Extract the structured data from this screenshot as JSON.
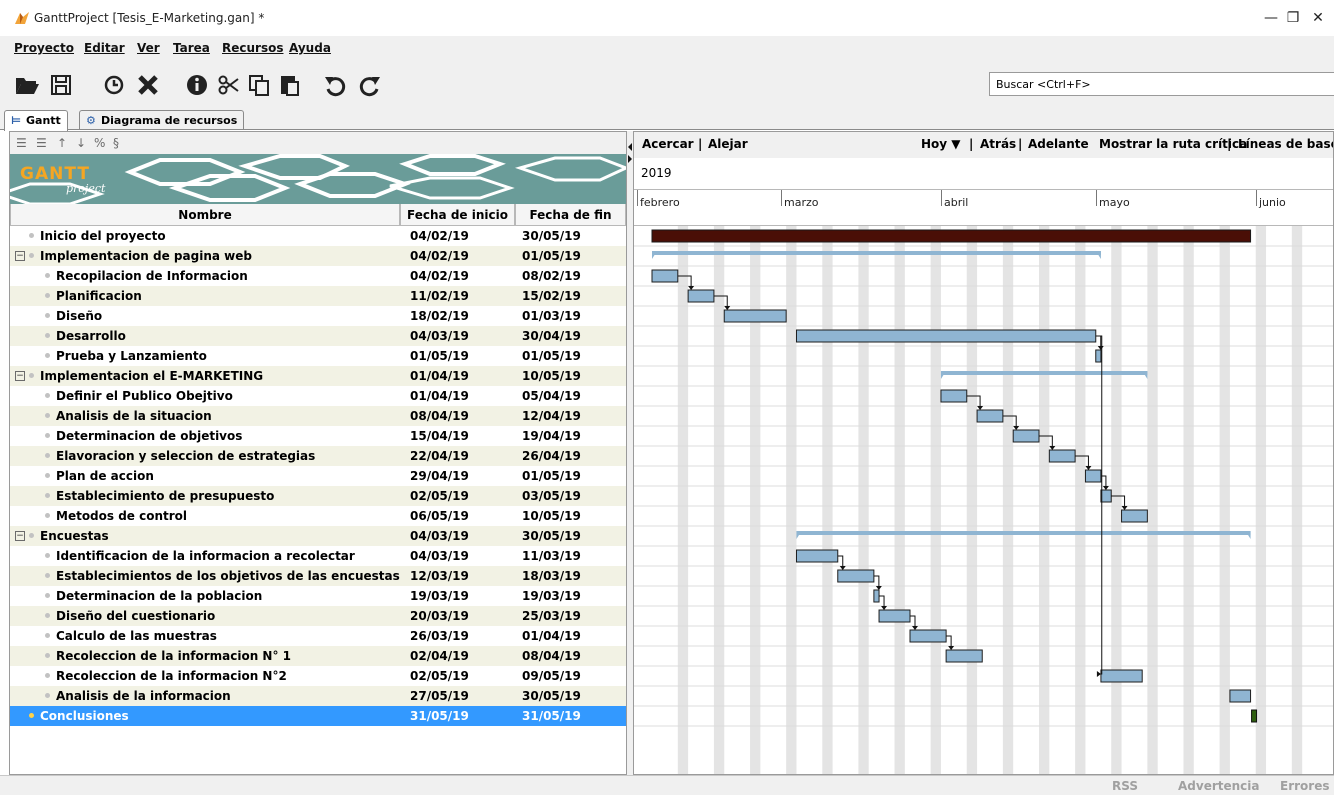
{
  "window": {
    "title": "GanttProject [Tesis_E-Marketing.gan] *",
    "minimize": "—",
    "restore": "❐",
    "close": "✕"
  },
  "menu": [
    "Proyecto",
    "Editar",
    "Ver",
    "Tarea",
    "Recursos",
    "Ayuda"
  ],
  "toolbar": {
    "icons": [
      "folder-open-icon",
      "save-icon",
      "clock-icon",
      "delete-icon",
      "info-icon",
      "cut-icon",
      "copy-icon",
      "paste-icon",
      "undo-icon",
      "redo-icon"
    ],
    "search_value": "Buscar <Ctrl+F>"
  },
  "tabs": [
    {
      "label": "Gantt",
      "icon": "gantt-icon",
      "active": true
    },
    {
      "label": "Diagrama de recursos",
      "icon": "resources-icon",
      "active": false
    }
  ],
  "tree_toolbar": [
    "indent-icon",
    "outdent-icon",
    "move-up-icon",
    "move-down-icon",
    "link-icon",
    "unlink-icon"
  ],
  "banner": {
    "logo_main": "GANTT",
    "logo_sub": "project"
  },
  "columns": {
    "name": "Nombre",
    "start": "Fecha de inicio",
    "end": "Fecha de fin"
  },
  "tasks": [
    {
      "name": "Inicio del proyecto",
      "start": "04/02/19",
      "end": "30/05/19",
      "level": 1,
      "group": false
    },
    {
      "name": "Implementacion de pagina web",
      "start": "04/02/19",
      "end": "01/05/19",
      "level": 1,
      "group": true
    },
    {
      "name": "Recopilacion de Informacion",
      "start": "04/02/19",
      "end": "08/02/19",
      "level": 2,
      "group": false
    },
    {
      "name": "Planificacion",
      "start": "11/02/19",
      "end": "15/02/19",
      "level": 2,
      "group": false
    },
    {
      "name": "Diseño",
      "start": "18/02/19",
      "end": "01/03/19",
      "level": 2,
      "group": false
    },
    {
      "name": "Desarrollo",
      "start": "04/03/19",
      "end": "30/04/19",
      "level": 2,
      "group": false
    },
    {
      "name": "Prueba y Lanzamiento",
      "start": "01/05/19",
      "end": "01/05/19",
      "level": 2,
      "group": false
    },
    {
      "name": "Implementacion el E-MARKETING",
      "start": "01/04/19",
      "end": "10/05/19",
      "level": 1,
      "group": true
    },
    {
      "name": "Definir el Publico Obejtivo",
      "start": "01/04/19",
      "end": "05/04/19",
      "level": 2,
      "group": false
    },
    {
      "name": "Analisis de la situacion",
      "start": "08/04/19",
      "end": "12/04/19",
      "level": 2,
      "group": false
    },
    {
      "name": "Determinacion de objetivos",
      "start": "15/04/19",
      "end": "19/04/19",
      "level": 2,
      "group": false
    },
    {
      "name": "Elavoracion y seleccion de estrategias",
      "start": "22/04/19",
      "end": "26/04/19",
      "level": 2,
      "group": false
    },
    {
      "name": "Plan de accion",
      "start": "29/04/19",
      "end": "01/05/19",
      "level": 2,
      "group": false
    },
    {
      "name": "Establecimiento de presupuesto",
      "start": "02/05/19",
      "end": "03/05/19",
      "level": 2,
      "group": false
    },
    {
      "name": "Metodos de control",
      "start": "06/05/19",
      "end": "10/05/19",
      "level": 2,
      "group": false
    },
    {
      "name": "Encuestas",
      "start": "04/03/19",
      "end": "30/05/19",
      "level": 1,
      "group": true
    },
    {
      "name": "Identificacion de la informacion a recolectar",
      "start": "04/03/19",
      "end": "11/03/19",
      "level": 2,
      "group": false
    },
    {
      "name": "Establecimientos de los objetivos de las encuestas",
      "start": "12/03/19",
      "end": "18/03/19",
      "level": 2,
      "group": false
    },
    {
      "name": "Determinacion de la poblacion",
      "start": "19/03/19",
      "end": "19/03/19",
      "level": 2,
      "group": false
    },
    {
      "name": "Diseño del cuestionario",
      "start": "20/03/19",
      "end": "25/03/19",
      "level": 2,
      "group": false
    },
    {
      "name": "Calculo de las muestras",
      "start": "26/03/19",
      "end": "01/04/19",
      "level": 2,
      "group": false
    },
    {
      "name": "Recoleccion de la informacion N° 1",
      "start": "02/04/19",
      "end": "08/04/19",
      "level": 2,
      "group": false
    },
    {
      "name": "Recoleccion de la informacion N°2",
      "start": "02/05/19",
      "end": "09/05/19",
      "level": 2,
      "group": false
    },
    {
      "name": "Analisis de la informacion",
      "start": "27/05/19",
      "end": "30/05/19",
      "level": 2,
      "group": false
    },
    {
      "name": "Conclusiones",
      "start": "31/05/19",
      "end": "31/05/19",
      "level": 1,
      "group": false,
      "selected": true
    }
  ],
  "chart_toolbar": {
    "zoom_in": "Acercar",
    "zoom_out": "Alejar",
    "today": "Hoy ▼",
    "back": "Atrás",
    "forward": "Adelante",
    "critical_path": "Mostrar la ruta crítica",
    "baselines": "Líneas de base...",
    "separator": "|"
  },
  "timeline": {
    "year": "2019",
    "months": [
      "febrero",
      "marzo",
      "abril",
      "mayo",
      "junio"
    ]
  },
  "colors": {
    "bar": "#8fb5d2",
    "bar_border": "#1e1e1e",
    "summary": "#8fb5d2",
    "milestone_bar": "#4a0f06",
    "selected_row": "#3399ff",
    "alt_row": "#f2f2e4",
    "weekend": "#e4e4e4"
  },
  "status": [
    "RSS",
    "Advertencia",
    "Errores"
  ]
}
